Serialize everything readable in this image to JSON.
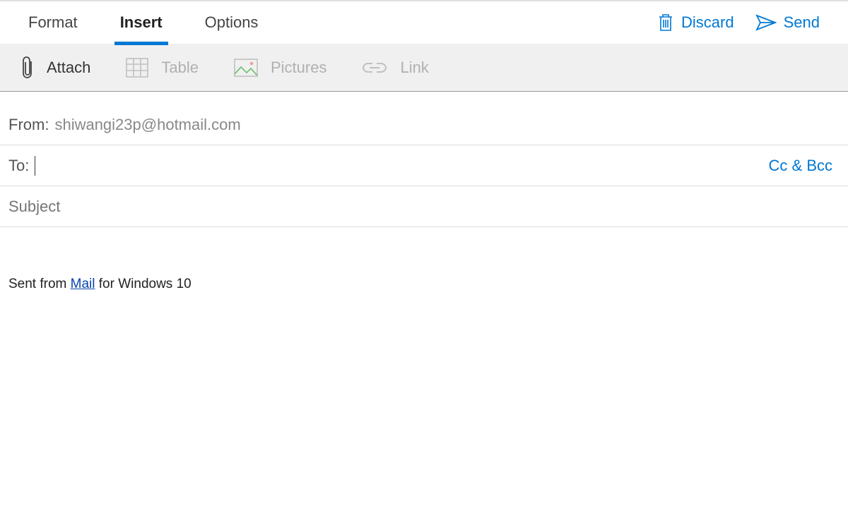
{
  "tabs": {
    "format": "Format",
    "insert": "Insert",
    "options": "Options",
    "active": "insert"
  },
  "actions": {
    "discard": "Discard",
    "send": "Send"
  },
  "toolbar": {
    "attach": "Attach",
    "table": "Table",
    "pictures": "Pictures",
    "link": "Link"
  },
  "compose": {
    "from_label": "From:",
    "from_value": "shiwangi23p@hotmail.com",
    "to_label": "To:",
    "to_value": "",
    "ccbcc": "Cc & Bcc",
    "subject_placeholder": "Subject",
    "subject_value": ""
  },
  "body": {
    "signature_prefix": "Sent from ",
    "signature_link": "Mail",
    "signature_suffix": " for Windows 10"
  }
}
